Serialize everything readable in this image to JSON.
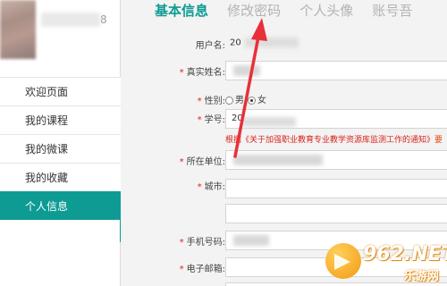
{
  "sidebar": {
    "user": {
      "name_tail": "8"
    },
    "menu": [
      {
        "label": "欢迎页面"
      },
      {
        "label": "我的课程"
      },
      {
        "label": "我的微课"
      },
      {
        "label": "我的收藏"
      },
      {
        "label": "个人信息",
        "active": true
      }
    ],
    "collapse_icon": "collapse-left-icon"
  },
  "tabs": [
    {
      "label": "基本信息",
      "active": true
    },
    {
      "label": "修改密码"
    },
    {
      "label": "个人头像"
    },
    {
      "label": "账号吾"
    }
  ],
  "form": {
    "username_label": "用户名:",
    "username_value": "20",
    "realname_label": "真实姓名:",
    "gender_label": "性别:",
    "gender_male": "男",
    "gender_female": "女",
    "gender_selected": "女",
    "id_label": "学号:",
    "id_value": "20",
    "notice": "根据《关于加强职业教育专业教学资源库监测工作的通知》",
    "notice_tail": "要",
    "unit_label": "所在单位:",
    "city_label": "城市:",
    "phone_label": "手机号码:",
    "email_label": "电子邮箱:"
  },
  "watermark": {
    "text": "962.NET",
    "sub": "乐游网"
  },
  "colors": {
    "accent": "#0e9b94",
    "required": "#d9231d",
    "annotation_arrow": "#e8303a"
  }
}
